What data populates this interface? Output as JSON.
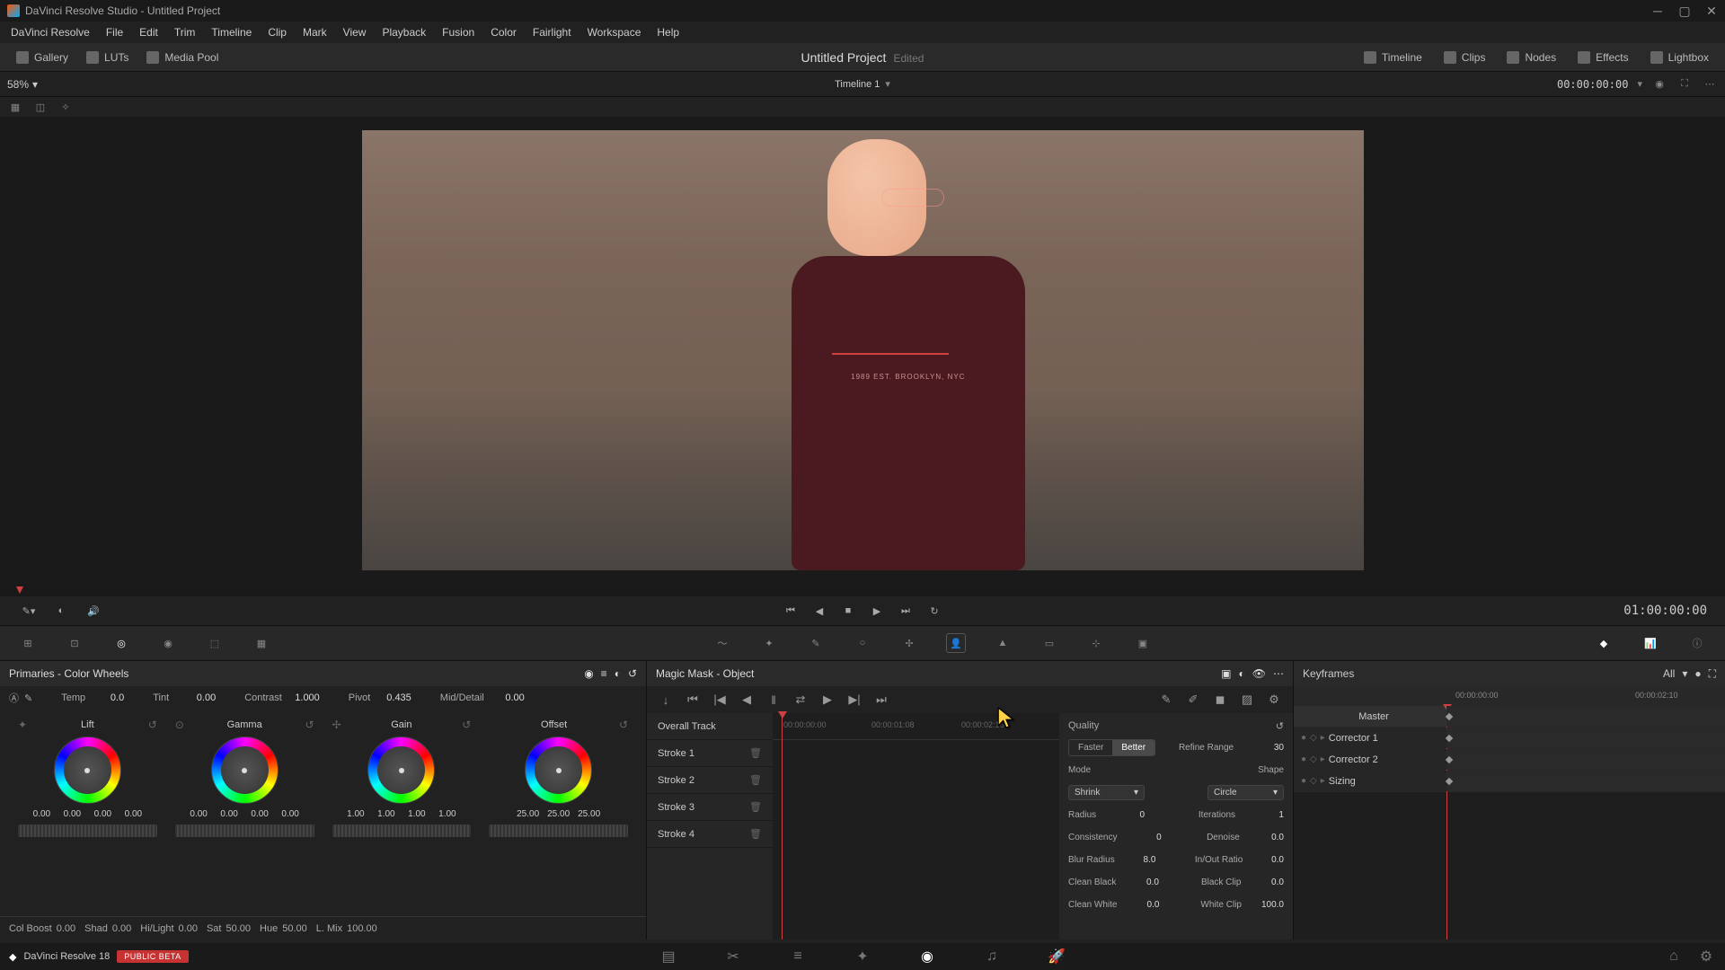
{
  "app_title": "DaVinci Resolve Studio - Untitled Project",
  "menubar": [
    "DaVinci Resolve",
    "File",
    "Edit",
    "Trim",
    "Timeline",
    "Clip",
    "Mark",
    "View",
    "Playback",
    "Fusion",
    "Color",
    "Fairlight",
    "Workspace",
    "Help"
  ],
  "toolbar": {
    "gallery": "Gallery",
    "luts": "LUTs",
    "mediapool": "Media Pool",
    "timeline": "Timeline",
    "clips": "Clips",
    "nodes": "Nodes",
    "effects": "Effects",
    "lightbox": "Lightbox"
  },
  "project": {
    "name": "Untitled Project",
    "status": "Edited"
  },
  "zoom": "58%",
  "timeline_name": "Timeline 1",
  "viewer_tc": "00:00:00:00",
  "transport_tc": "01:00:00:00",
  "shirt_text": "1989 EST. BROOKLYN, NYC",
  "primaries": {
    "title": "Primaries - Color Wheels",
    "params": {
      "temp": "Temp",
      "temp_v": "0.0",
      "tint": "Tint",
      "tint_v": "0.00",
      "contrast": "Contrast",
      "contrast_v": "1.000",
      "pivot": "Pivot",
      "pivot_v": "0.435",
      "md": "Mid/Detail",
      "md_v": "0.00"
    },
    "wheels": [
      {
        "name": "Lift",
        "v": [
          "0.00",
          "0.00",
          "0.00",
          "0.00"
        ]
      },
      {
        "name": "Gamma",
        "v": [
          "0.00",
          "0.00",
          "0.00",
          "0.00"
        ]
      },
      {
        "name": "Gain",
        "v": [
          "1.00",
          "1.00",
          "1.00",
          "1.00"
        ]
      },
      {
        "name": "Offset",
        "v": [
          "25.00",
          "25.00",
          "25.00"
        ]
      }
    ],
    "bottom": {
      "cb": "Col Boost",
      "cb_v": "0.00",
      "shad": "Shad",
      "shad_v": "0.00",
      "hl": "Hi/Light",
      "hl_v": "0.00",
      "sat": "Sat",
      "sat_v": "50.00",
      "hue": "Hue",
      "hue_v": "50.00",
      "lmix": "L. Mix",
      "lmix_v": "100.00"
    }
  },
  "magic": {
    "title": "Magic Mask - Object",
    "overall": "Overall Track",
    "strokes": [
      "Stroke 1",
      "Stroke 2",
      "Stroke 3",
      "Stroke 4"
    ],
    "ruler": [
      "00:00:00:00",
      "00:00:01:08",
      "00:00:02:16"
    ],
    "quality": {
      "hdr": "Quality",
      "faster": "Faster",
      "better": "Better",
      "refine": "Refine Range",
      "refine_v": "30",
      "mode": "Mode",
      "mode_v": "Shrink",
      "shape": "Shape",
      "shape_v": "Circle",
      "radius": "Radius",
      "radius_v": "0",
      "iter": "Iterations",
      "iter_v": "1",
      "cons": "Consistency",
      "cons_v": "0",
      "denoise": "Denoise",
      "denoise_v": "0.0",
      "blur": "Blur Radius",
      "blur_v": "8.0",
      "inout": "In/Out Ratio",
      "inout_v": "0.0",
      "cblack": "Clean Black",
      "cblack_v": "0.0",
      "bclip": "Black Clip",
      "bclip_v": "0.0",
      "cwhite": "Clean White",
      "cwhite_v": "0.0",
      "wclip": "White Clip",
      "wclip_v": "100.0"
    }
  },
  "keyframes": {
    "title": "Keyframes",
    "all": "All",
    "master": "Master",
    "tracks": [
      "Corrector 1",
      "Corrector 2",
      "Sizing"
    ],
    "tc1": "00:00:00:00",
    "tc2": "00:00:02:10"
  },
  "footer": {
    "name": "DaVinci Resolve 18",
    "beta": "PUBLIC BETA"
  }
}
